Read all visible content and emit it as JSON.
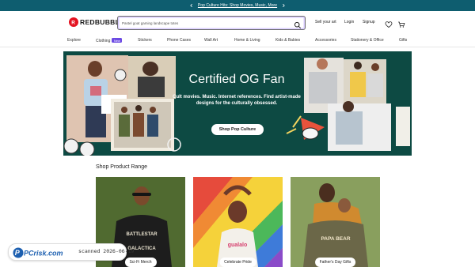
{
  "promo": {
    "text": "Pop Culture Hits: Shop Movies, Music, More"
  },
  "header": {
    "logo": "REDBUBBLE",
    "search_placeholder": "Pastel goat gaming landscape totes",
    "sell": "Sell your art",
    "login": "Login",
    "signup": "Signup"
  },
  "nav": {
    "items": [
      "Explore",
      "Clothing",
      "Stickers",
      "Phone Cases",
      "Wall Art",
      "Home & Living",
      "Kids & Babies",
      "Accessories",
      "Stationery & Office",
      "Gifts"
    ],
    "badge": "New"
  },
  "hero": {
    "title": "Certified OG Fan",
    "subtitle": "Cult movies. Music. Internet references. Find artist-made designs for the culturally obsessed.",
    "cta": "Shop Pop Culture"
  },
  "range": {
    "title": "Shop Product Range",
    "cards": [
      {
        "label": "Sci-Fi Merch",
        "shirt_text": "BATTLESTAR GALACTICA"
      },
      {
        "label": "Celebrate Pride",
        "shirt_text": "gualalo"
      },
      {
        "label": "Father's Day Gifts",
        "shirt_text": "PAPA BEAR"
      }
    ]
  },
  "watermark": {
    "brand": "PCrisk.com",
    "text": "scanned 2026-06-19"
  },
  "colors": {
    "promo_bg": "#0e5d6f",
    "hero_bg": "#0d4a43",
    "badge": "#6c4ae3",
    "logo_red": "#e41321"
  }
}
